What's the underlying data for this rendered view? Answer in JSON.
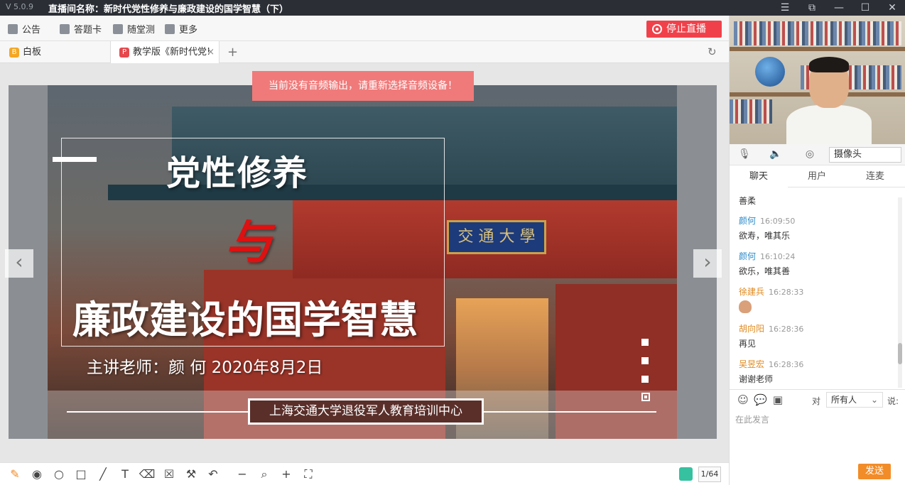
{
  "window": {
    "version": "V 5.0.9",
    "title": "直播间名称：新时代党性修养与廉政建设的国学智慧（下）"
  },
  "toolbar": {
    "notice": "公告",
    "answer_card": "答题卡",
    "quiz": "随堂测",
    "more": "更多",
    "stop_live": "停止直播"
  },
  "tabs": [
    {
      "label": "白板"
    },
    {
      "label": "教学版《新时代党!"
    }
  ],
  "toast": "当前没有音频输出，请重新选择音频设备！",
  "slide": {
    "plaque": "交 通 大 學",
    "title1": "党性修养",
    "title2": "与",
    "title3": "廉政建设的国学智慧",
    "speaker": "主讲老师：颜 何   2020年8月2日",
    "org": "上海交通大学退役军人教育培训中心"
  },
  "pager": {
    "page": "1/64"
  },
  "device": {
    "camera": "摄像头"
  },
  "chat_tabs": [
    "聊天",
    "用户",
    "连麦"
  ],
  "messages": [
    {
      "name": "",
      "time": "",
      "text": "善柔"
    },
    {
      "name": "颜何",
      "time": "16:09:50",
      "text": "欲寿，唯其乐"
    },
    {
      "name": "颜何",
      "time": "16:10:24",
      "text": "欲乐，唯其善"
    },
    {
      "name": "徐建兵",
      "time": "16:28:33",
      "text": ""
    },
    {
      "name": "胡向阳",
      "time": "16:28:36",
      "text": "再见"
    },
    {
      "name": "吴昱宏",
      "time": "16:28:36",
      "text": "谢谢老师"
    }
  ],
  "chat_input": {
    "to_label": "对",
    "to_value": "所有人",
    "say_label": "说:",
    "placeholder": "在此发言",
    "send": "发送"
  }
}
